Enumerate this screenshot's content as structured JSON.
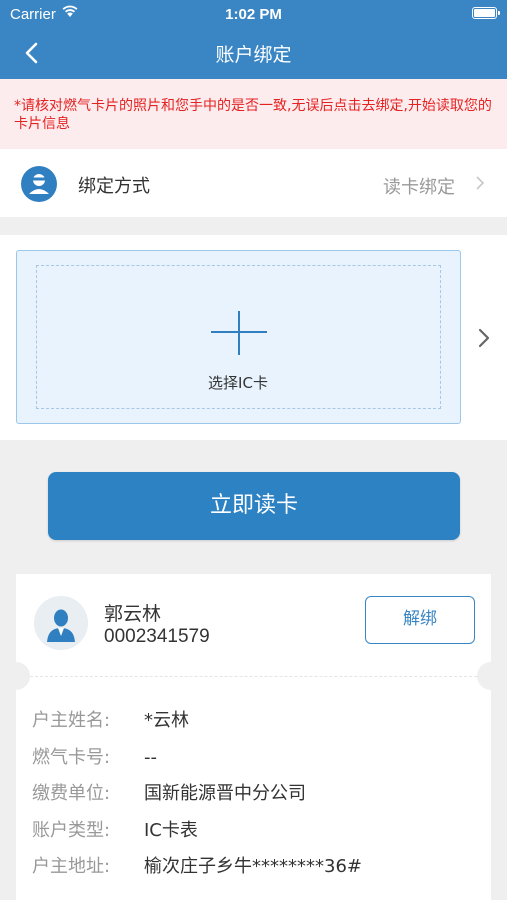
{
  "status_bar": {
    "carrier": "Carrier",
    "time": "1:02 PM"
  },
  "nav": {
    "title": "账户绑定",
    "back_icon": "chevron-left-icon"
  },
  "notice": {
    "text": "*请核对燃气卡片的照片和您手中的是否一致,无误后点击去绑定,开始读取您的卡片信息",
    "color": "#e52222"
  },
  "bind_method": {
    "label": "绑定方式",
    "value": "读卡绑定",
    "icon": "user-circle-icon"
  },
  "card_select": {
    "label": "选择IC卡",
    "icon": "plus-icon"
  },
  "read_button": {
    "label": "立即读卡"
  },
  "account": {
    "name": "郭云林",
    "number": "0002341579",
    "unbind_label": "解绑",
    "details": [
      {
        "key": "户主姓名:",
        "value": "*云林"
      },
      {
        "key": "燃气卡号:",
        "value": "--"
      },
      {
        "key": "缴费单位:",
        "value": "国新能源晋中分公司"
      },
      {
        "key": "账户类型:",
        "value": "IC卡表"
      },
      {
        "key": "户主地址:",
        "value": "榆次庄子乡牛********36#"
      }
    ]
  },
  "colors": {
    "primary": "#3a86c4",
    "button": "#2d82c4",
    "background": "#efefef"
  }
}
